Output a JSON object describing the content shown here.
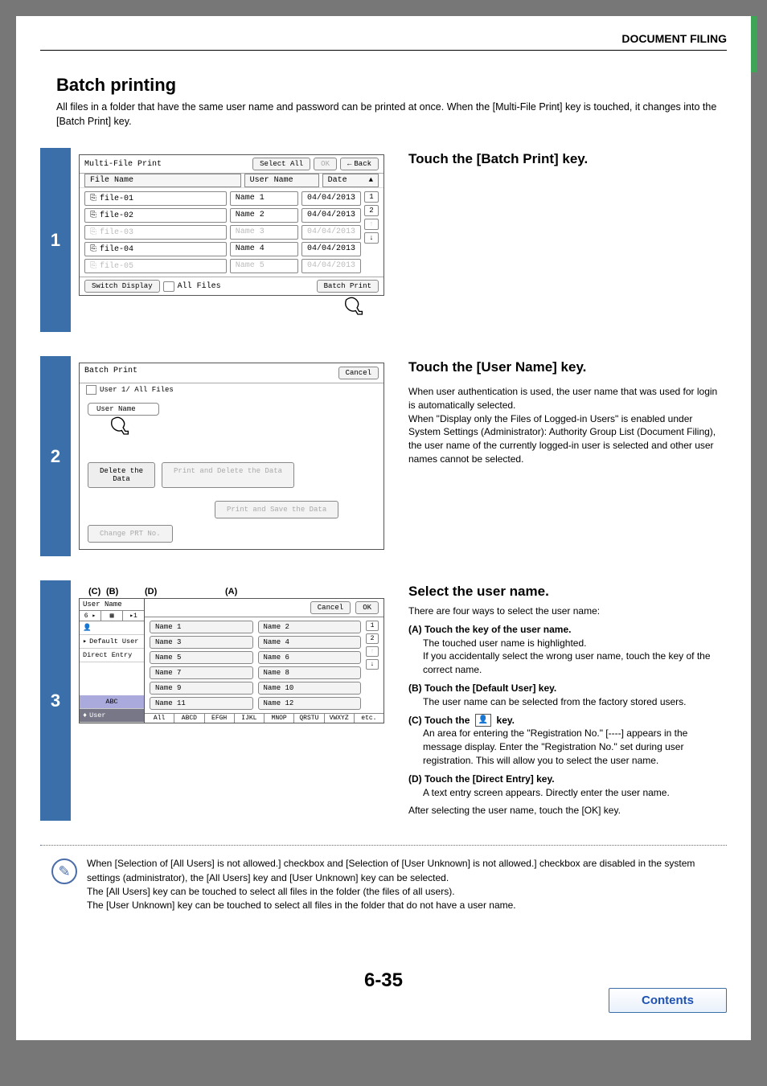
{
  "header": {
    "section": "DOCUMENT FILING"
  },
  "title": "Batch printing",
  "intro": "All files in a folder that have the same user name and password can be printed at once. When the [Multi-File Print] key is touched, it changes into the [Batch Print] key.",
  "page_number": "6-35",
  "contents_button": "Contents",
  "step1": {
    "heading": "Touch the [Batch Print] key.",
    "panel_title": "Multi-File Print",
    "select_all": "Select All",
    "ok": "OK",
    "back": "Back",
    "cols": {
      "file": "File Name",
      "user": "User Name",
      "date": "Date"
    },
    "rows": [
      {
        "file": "file-01",
        "user": "Name 1",
        "date": "04/04/2013",
        "faded": false
      },
      {
        "file": "file-02",
        "user": "Name 2",
        "date": "04/04/2013",
        "faded": false
      },
      {
        "file": "file-03",
        "user": "Name 3",
        "date": "04/04/2013",
        "faded": true
      },
      {
        "file": "file-04",
        "user": "Name 4",
        "date": "04/04/2013",
        "faded": false
      },
      {
        "file": "file-05",
        "user": "Name 5",
        "date": "04/04/2013",
        "faded": true
      }
    ],
    "pager": [
      "1",
      "2",
      "↑",
      "↓"
    ],
    "footer": {
      "switch": "Switch Display",
      "all_files": "All Files",
      "batch": "Batch Print"
    }
  },
  "step2": {
    "heading": "Touch the [User Name] key.",
    "body": "When user authentication is used, the user name that was used for login is automatically selected.\nWhen \"Display only the Files of Logged-in Users\" is enabled under System Settings (Administrator): Authority Group List (Document Filing), the user name of the currently logged-in user is selected and other user names cannot be selected.",
    "panel_title": "Batch Print",
    "cancel": "Cancel",
    "path": "User 1/  All Files",
    "field": "User Name",
    "buttons": {
      "delete": "Delete the\nData",
      "print_del": "Print and Delete the Data",
      "print_save": "Print and Save the Data",
      "change": "Change PRT No."
    }
  },
  "step3": {
    "heading": "Select the user name.",
    "lead": "There are four ways to select the user name:",
    "opts": {
      "a_t": "(A) Touch the key of the user name.",
      "a_d": "The touched user name is highlighted.\nIf you accidentally select the wrong user name, touch the key of the correct name.",
      "b_t": "(B) Touch the [Default User] key.",
      "b_d": "The user name can be selected from the factory stored users.",
      "c_t": "(C) Touch the        key.",
      "c_d": "An area for entering the \"Registration No.\" [----] appears in the message display. Enter the \"Registration No.\" set during user registration. This will allow you to select the user name.",
      "d_t": "(D) Touch the [Direct Entry] key.",
      "d_d": "A text entry screen appears. Directly enter the user name."
    },
    "after": "After selecting the user name, touch the [OK] key.",
    "labels": {
      "c": "(C)",
      "b": "(B)",
      "d": "(D)",
      "a": "(A)"
    },
    "panel": {
      "left_title": "User Name",
      "tabs": [
        "6 ▸",
        "▦",
        "▸1"
      ],
      "rows": {
        "default": "Default User",
        "direct": "Direct Entry",
        "abc": "ABC",
        "user": "User"
      },
      "cancel": "Cancel",
      "ok": "OK",
      "names_col1": [
        "Name 1",
        "Name 3",
        "Name 5",
        "Name 7",
        "Name 9",
        "Name 11"
      ],
      "names_col2": [
        "Name 2",
        "Name 4",
        "Name 6",
        "Name 8",
        "Name 10",
        "Name 12"
      ],
      "pager": [
        "1",
        "2",
        "↑",
        "↓"
      ],
      "alpha": [
        "All",
        "ABCD",
        "EFGH",
        "IJKL",
        "MNOP",
        "QRSTU",
        "VWXYZ",
        "etc."
      ]
    }
  },
  "note": "When [Selection of [All Users] is not allowed.] checkbox and [Selection of [User Unknown] is not allowed.] checkbox are disabled in the system settings (administrator), the [All Users] key and [User Unknown] key can be selected.\nThe [All Users] key can be touched to select all files in the folder (the files of all users).\nThe [User Unknown] key can be touched to select all files in the folder that do not have a user name."
}
